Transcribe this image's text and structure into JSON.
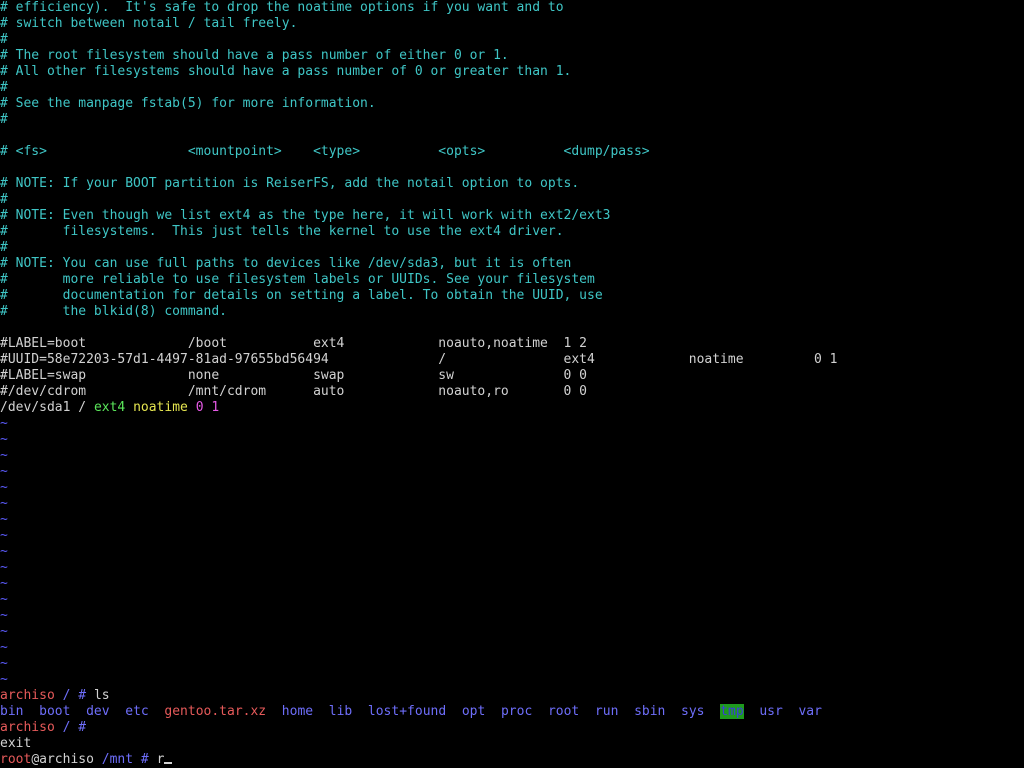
{
  "editor": {
    "comment_lines": [
      "# efficiency).  It's safe to drop the noatime options if you want and to",
      "# switch between notail / tail freely.",
      "#",
      "# The root filesystem should have a pass number of either 0 or 1.",
      "# All other filesystems should have a pass number of 0 or greater than 1.",
      "#",
      "# See the manpage fstab(5) for more information.",
      "#",
      "",
      "# <fs>                  <mountpoint>    <type>          <opts>          <dump/pass>",
      "",
      "# NOTE: If your BOOT partition is ReiserFS, add the notail option to opts.",
      "#",
      "# NOTE: Even though we list ext4 as the type here, it will work with ext2/ext3",
      "#       filesystems.  This just tells the kernel to use the ext4 driver.",
      "#",
      "# NOTE: You can use full paths to devices like /dev/sda3, but it is often",
      "#       more reliable to use filesystem labels or UUIDs. See your filesystem",
      "#       documentation for details on setting a label. To obtain the UUID, use",
      "#       the blkid(8) command.",
      ""
    ],
    "entry_lines": [
      "#LABEL=boot             /boot           ext4            noauto,noatime  1 2",
      "#UUID=58e72203-57d1-4497-81ad-97655bd56494              /               ext4            noatime         0 1",
      "#LABEL=swap             none            swap            sw              0 0",
      "#/dev/cdrom             /mnt/cdrom      auto            noauto,ro       0 0"
    ],
    "active_entry": {
      "device": "/dev/sda1",
      "mountpoint": "/",
      "type": "ext4",
      "options": "noatime",
      "dump": "0",
      "pass": "1"
    },
    "tilde": "~"
  },
  "shell": {
    "prompt_host": "archiso",
    "prompt_path_root": "/",
    "prompt_symbol": "#",
    "cmd_ls": "ls",
    "ls_output": [
      {
        "name": "bin",
        "kind": "dir"
      },
      {
        "name": "boot",
        "kind": "dir"
      },
      {
        "name": "dev",
        "kind": "dir"
      },
      {
        "name": "etc",
        "kind": "dir"
      },
      {
        "name": "gentoo.tar.xz",
        "kind": "archive"
      },
      {
        "name": "home",
        "kind": "dir"
      },
      {
        "name": "lib",
        "kind": "dir"
      },
      {
        "name": "lost+found",
        "kind": "dir"
      },
      {
        "name": "opt",
        "kind": "dir"
      },
      {
        "name": "proc",
        "kind": "dir"
      },
      {
        "name": "root",
        "kind": "dir"
      },
      {
        "name": "run",
        "kind": "dir"
      },
      {
        "name": "sbin",
        "kind": "dir"
      },
      {
        "name": "sys",
        "kind": "dir"
      },
      {
        "name": "tmp",
        "kind": "sticky"
      },
      {
        "name": "usr",
        "kind": "dir"
      },
      {
        "name": "var",
        "kind": "dir"
      }
    ],
    "exit_text": "exit",
    "last_user": "root",
    "last_host": "@archiso",
    "last_path": "/mnt",
    "last_input": "r"
  },
  "colors": {
    "background": "#000000",
    "comment": "#3fc6c6",
    "tilde": "#5a5afa",
    "prompt": "#e65a5a",
    "dir": "#6e6efa",
    "archive": "#e65a5a",
    "sticky_bg": "#1e9a1e"
  }
}
